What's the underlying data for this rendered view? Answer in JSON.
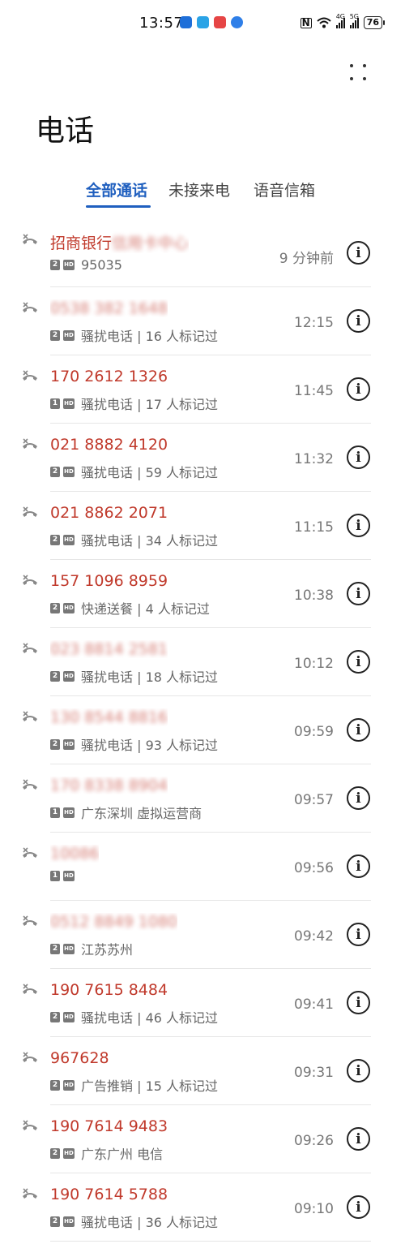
{
  "status": {
    "time": "13:57",
    "network_1": "4G",
    "network_2": "5G",
    "wifi_tag": "6",
    "battery": "76",
    "app_colors": [
      "#1e6fd9",
      "#2aa3e6",
      "#e64545",
      "#2f7fe8"
    ]
  },
  "header": {
    "title": "电话",
    "more_icon": "more-dots-icon"
  },
  "tabs": [
    {
      "label": "全部通话",
      "active": true
    },
    {
      "label": "未接来电",
      "active": false
    },
    {
      "label": "语音信箱",
      "active": false
    }
  ],
  "calls": [
    {
      "name": "招商银行",
      "name_blurred": "信用卡中心",
      "sim": "2",
      "detail": "95035",
      "time": "9 分钟前"
    },
    {
      "name": "",
      "name_blurred": "0538 382 1648",
      "sim": "2",
      "detail": "骚扰电话 | 16 人标记过",
      "time": "12:15"
    },
    {
      "name": "170 2612 1326",
      "name_blurred": "",
      "sim": "1",
      "detail": "骚扰电话 | 17 人标记过",
      "time": "11:45"
    },
    {
      "name": "021 8882 4120",
      "name_blurred": "",
      "sim": "2",
      "detail": "骚扰电话 | 59 人标记过",
      "time": "11:32"
    },
    {
      "name": "021 8862 2071",
      "name_blurred": "",
      "sim": "2",
      "detail": "骚扰电话 | 34 人标记过",
      "time": "11:15"
    },
    {
      "name": "157 1096 8959",
      "name_blurred": "",
      "sim": "2",
      "detail": "快递送餐 | 4 人标记过",
      "time": "10:38"
    },
    {
      "name": "",
      "name_blurred": "023 8814 2581",
      "sim": "2",
      "detail": "骚扰电话 | 18 人标记过",
      "time": "10:12"
    },
    {
      "name": "",
      "name_blurred": "130 8544 8816",
      "sim": "2",
      "detail": "骚扰电话 | 93 人标记过",
      "time": "09:59"
    },
    {
      "name": "",
      "name_blurred": "170 8338 8904",
      "sim": "1",
      "detail": "广东深圳 虚拟运营商",
      "time": "09:57"
    },
    {
      "name": "",
      "name_blurred": "10086",
      "sim": "1",
      "detail": "",
      "time": "09:56"
    },
    {
      "name": "",
      "name_blurred": "0512 8849 1080",
      "sim": "2",
      "detail": "江苏苏州",
      "time": "09:42"
    },
    {
      "name": "190 7615 8484",
      "name_blurred": "",
      "sim": "2",
      "detail": "骚扰电话 | 46 人标记过",
      "time": "09:41"
    },
    {
      "name": "967628",
      "name_blurred": "",
      "sim": "2",
      "detail": "广告推销 | 15 人标记过",
      "time": "09:31"
    },
    {
      "name": "190 7614 9483",
      "name_blurred": "",
      "sim": "2",
      "detail": "广东广州 电信",
      "time": "09:26"
    },
    {
      "name": "190 7614 5788",
      "name_blurred": "",
      "sim": "2",
      "detail": "骚扰电话 | 36 人标记过",
      "time": "09:10"
    }
  ]
}
